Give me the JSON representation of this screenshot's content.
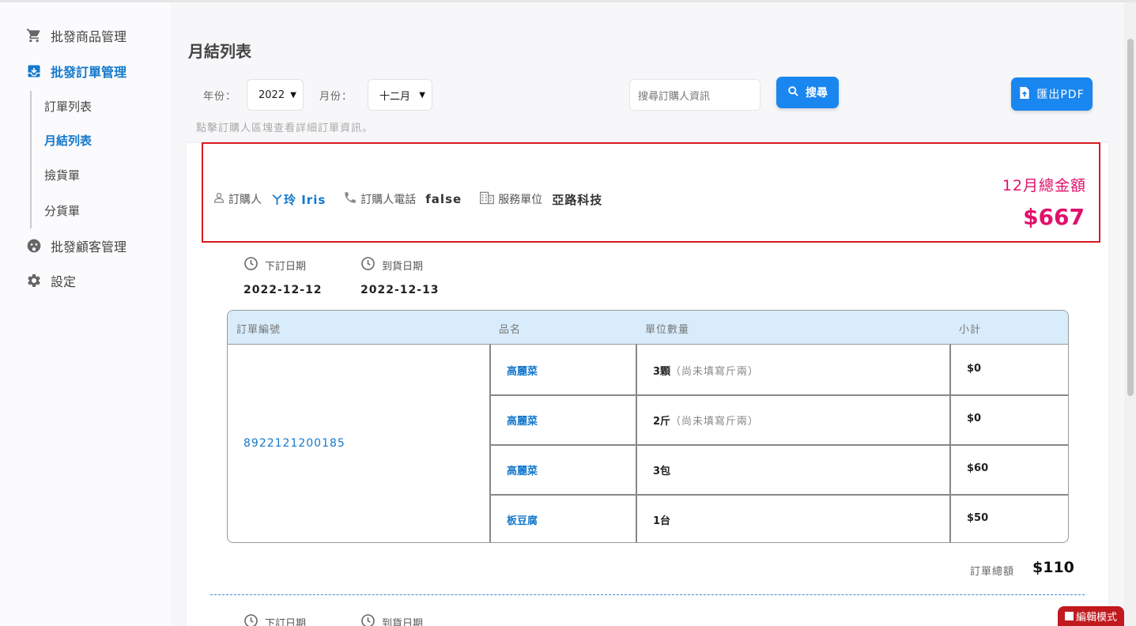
{
  "sidebar": {
    "items": [
      {
        "label": "批發商品管理",
        "icon": "cart-icon"
      },
      {
        "label": "批發訂單管理",
        "icon": "download-box-icon",
        "active": true
      },
      {
        "label": "批發顧客管理",
        "icon": "face-icon"
      },
      {
        "label": "設定",
        "icon": "gear-icon"
      }
    ],
    "sub_items": [
      "訂單列表",
      "月結列表",
      "撿貨單",
      "分貨單"
    ],
    "active_sub": "月結列表"
  },
  "page": {
    "title": "月結列表",
    "year_label": "年份：",
    "year_value": "2022",
    "month_label": "月份：",
    "month_value": "十二月",
    "search_placeholder": "搜尋訂購人資訊",
    "search_button": "搜尋",
    "export_button": "匯出PDF",
    "hint": "點擊訂購人區塊查看詳細訂單資訊。"
  },
  "buyer": {
    "buyer_label": "訂購人",
    "buyer_name": "ㄚ玲 Iris",
    "phone_label": "訂購人電話",
    "phone_value": "false",
    "unit_label": "服務單位",
    "unit_value": "亞路科技",
    "total_label": "12月總金額",
    "total_value": "$667"
  },
  "order": {
    "order_date_label": "下訂日期",
    "order_date": "2022-12-12",
    "arrival_date_label": "到貨日期",
    "arrival_date": "2022-12-13",
    "columns": [
      "訂單編號",
      "品名",
      "單位數量",
      "小計"
    ],
    "order_no": "8922121200185",
    "rows": [
      {
        "name": "高麗菜",
        "qty": "3顆",
        "note": "（尚未填寫斤兩）",
        "subtotal": "$0"
      },
      {
        "name": "高麗菜",
        "qty": "2斤",
        "note": "（尚未填寫斤兩）",
        "subtotal": "$0"
      },
      {
        "name": "高麗菜",
        "qty": "3包",
        "note": "",
        "subtotal": "$60"
      },
      {
        "name": "板豆腐",
        "qty": "1台",
        "note": "",
        "subtotal": "$50"
      }
    ],
    "total_label": "訂單總額",
    "total_value": "$110"
  },
  "next_order": {
    "order_date_label": "下訂日期",
    "arrival_date_label": "到貨日期"
  },
  "edit_mode": "編輯模式",
  "colors": {
    "accent": "#1a86f0",
    "link": "#1478cc",
    "total": "#e0116b",
    "highlight_border": "#d81b22"
  }
}
